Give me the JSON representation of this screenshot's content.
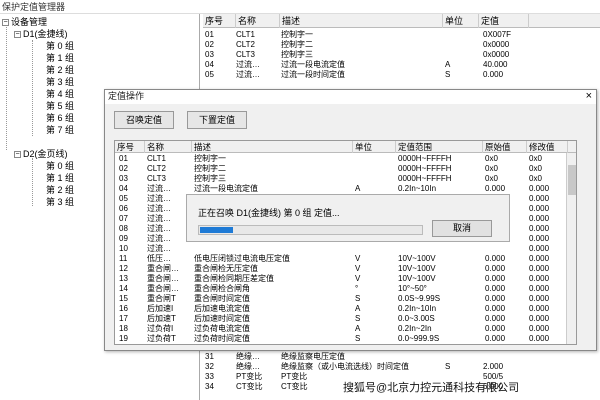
{
  "window": {
    "title": "保护定值管理器"
  },
  "tree": {
    "root": "设备管理",
    "d1": {
      "label": "D1(金捷线)",
      "groups": [
        "第 0 组",
        "第 1 组",
        "第 2 组",
        "第 3 组",
        "第 4 组",
        "第 5 组",
        "第 6 组",
        "第 7 组"
      ]
    },
    "d2": {
      "label": "D2(金页线)",
      "groups": [
        "第 0 组",
        "第 1 组",
        "第 2 组",
        "第 3 组"
      ]
    }
  },
  "main_table": {
    "headers": [
      "序号",
      "名称",
      "描述",
      "单位",
      "定值"
    ],
    "rows": [
      [
        "01",
        "CLT1",
        "控制字一",
        "",
        "0X007F"
      ],
      [
        "02",
        "CLT2",
        "控制字二",
        "",
        "0x0000"
      ],
      [
        "03",
        "CLT3",
        "控制字三",
        "",
        "0x0000"
      ],
      [
        "04",
        "过流…",
        "过流一段电流定值",
        "A",
        "40.000"
      ],
      [
        "05",
        "过流…",
        "过流一段时间定值",
        "S",
        "0.000"
      ]
    ],
    "bottom_rows": [
      [
        "31",
        "绝缘…",
        "绝缘监察电压定值",
        "",
        ""
      ],
      [
        "32",
        "绝缘…",
        "绝缘监察（或小电流选线）时间定值",
        "S",
        "2.000"
      ],
      [
        "33",
        "PT变比",
        "PT变比",
        "",
        "500/5"
      ],
      [
        "34",
        "CT变比",
        "CT变比",
        "",
        "6.000"
      ]
    ]
  },
  "dialog": {
    "title": "定值操作",
    "close": "×",
    "recall_button": "召唤定值",
    "download_button": "下置定值",
    "headers": [
      "序号",
      "名称",
      "描述",
      "单位",
      "定值范围",
      "原始值",
      "修改值"
    ],
    "rows": [
      [
        "01",
        "CLT1",
        "控制字一",
        "",
        "0000H~FFFFH",
        "0x0",
        "0x0"
      ],
      [
        "02",
        "CLT2",
        "控制字二",
        "",
        "0000H~FFFFH",
        "0x0",
        "0x0"
      ],
      [
        "03",
        "CLT3",
        "控制字三",
        "",
        "0000H~FFFFH",
        "0x0",
        "0x0"
      ],
      [
        "04",
        "过流…",
        "过流一段电流定值",
        "A",
        "0.2In~10In",
        "0.000",
        "0.000"
      ],
      [
        "05",
        "过流…",
        "",
        "",
        "",
        "",
        "0.000"
      ],
      [
        "06",
        "过流…",
        "",
        "",
        "",
        "",
        "0.000"
      ],
      [
        "07",
        "过流…",
        "",
        "",
        "",
        "",
        "0.000"
      ],
      [
        "08",
        "过流…",
        "",
        "",
        "",
        "",
        "0.000"
      ],
      [
        "09",
        "过流…",
        "",
        "",
        "",
        "",
        "0.000"
      ],
      [
        "10",
        "过流…",
        "",
        "",
        "",
        "",
        "0.000"
      ],
      [
        "11",
        "低压…",
        "低电压闭锁过电流电压定值",
        "V",
        "10V~100V",
        "0.000",
        "0.000"
      ],
      [
        "12",
        "重合闸…",
        "重合闸检无压定值",
        "V",
        "10V~100V",
        "0.000",
        "0.000"
      ],
      [
        "13",
        "重合闸…",
        "重合闸检同期压差定值",
        "V",
        "10V~100V",
        "0.000",
        "0.000"
      ],
      [
        "14",
        "重合闸…",
        "重合闸检合闸角",
        "°",
        "10°~50°",
        "0.000",
        "0.000"
      ],
      [
        "15",
        "重合闸T",
        "重合闸时间定值",
        "S",
        "0.0S~9.99S",
        "0.000",
        "0.000"
      ],
      [
        "16",
        "后加速I",
        "后加速电流定值",
        "A",
        "0.2In~10In",
        "0.000",
        "0.000"
      ],
      [
        "17",
        "后加速T",
        "后加速时间定值",
        "S",
        "0.0~3.00S",
        "0.000",
        "0.000"
      ],
      [
        "18",
        "过负荷I",
        "过负荷电流定值",
        "A",
        "0.2In~2In",
        "0.000",
        "0.000"
      ],
      [
        "19",
        "过负荷T",
        "过负荷时间定值",
        "S",
        "0.0~999.9S",
        "0.000",
        "0.000"
      ]
    ]
  },
  "progress": {
    "message": "正在召唤 D1(金捷线) 第 0 组 定值...",
    "cancel_button": "取消",
    "fraction": 0.15
  },
  "watermark": "搜狐号@北京力控元通科技有限公司",
  "colors": {
    "progress_fill": "#1f7bd6",
    "dialog_bg": "#f0f0f0"
  }
}
